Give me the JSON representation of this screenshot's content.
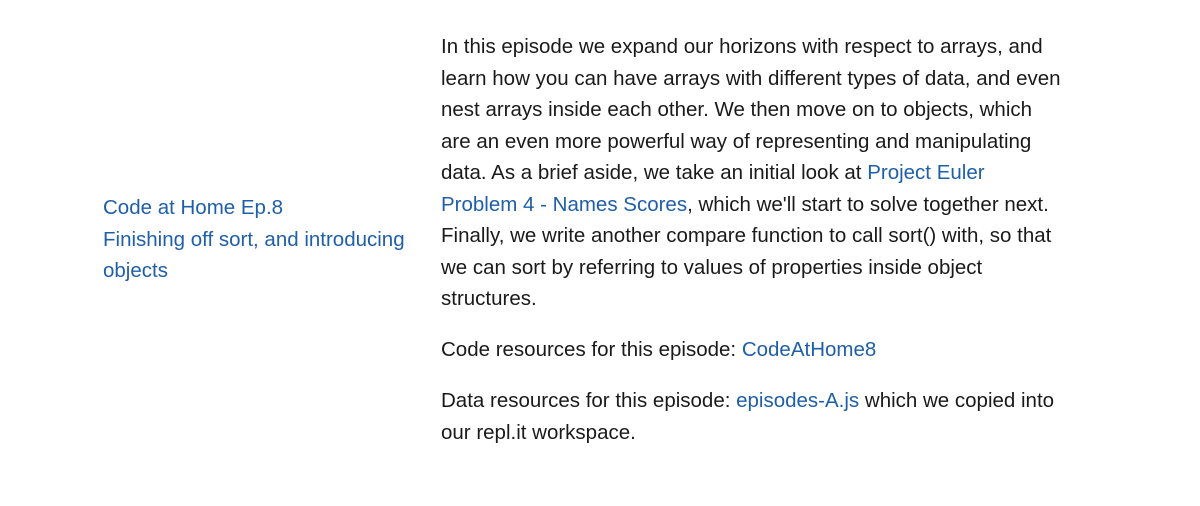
{
  "episode": {
    "title_link": "Code at Home Ep.8",
    "subtitle_link": "Finishing off sort, and introducing objects"
  },
  "description": {
    "part1": "In this episode we expand our horizons with respect to arrays, and learn how you can have arrays with different types of data, and even nest arrays inside each other. We then move on to objects, which are an even more powerful way of representing and manipulating data. As a brief aside, we take an initial look at ",
    "link": "Project Euler Problem 4 - Names Scores",
    "part2": ", which we'll start to solve together next. Finally, we write another compare function to call sort() with, so that we can sort by referring to values of properties inside object structures."
  },
  "code_resources": {
    "label": "Code resources for this episode: ",
    "link": "CodeAtHome8"
  },
  "data_resources": {
    "label": "Data resources for this episode: ",
    "link": "episodes-A.js",
    "suffix": " which we copied into our repl.it workspace."
  },
  "colors": {
    "link": "#1f5fa8",
    "text": "#1a1a1a",
    "background": "#ffffff"
  }
}
